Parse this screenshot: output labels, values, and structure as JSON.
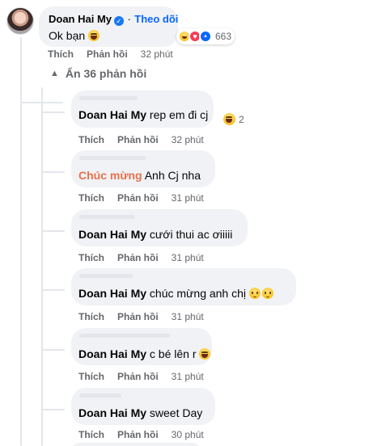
{
  "top_comment": {
    "author": "Doan Hai My",
    "separator": "·",
    "follow_label": "Theo dõi",
    "text": "Ok bạn",
    "reaction_count": "663",
    "like_label": "Thích",
    "reply_label": "Phản hồi",
    "time": "32 phút"
  },
  "hide_replies_label": "Ẩn 36 phản hồi",
  "replies": [
    {
      "name": "Doan Hai My",
      "text": "rep em đi cj",
      "react_count": "2",
      "like": "Thích",
      "reply": "Phản hồi",
      "time": "32 phút"
    },
    {
      "name": "Chúc mừng",
      "text": "Anh Cj nha",
      "like": "Thích",
      "reply": "Phản hồi",
      "time": "31 phút"
    },
    {
      "name": "Doan Hai My",
      "text": "cưới thui ac ơiiiii",
      "like": "Thích",
      "reply": "Phản hồi",
      "time": "31 phút"
    },
    {
      "name": "Doan Hai My",
      "text": "chúc mừng anh chị",
      "like": "Thích",
      "reply": "Phản hồi",
      "time": "31 phút"
    },
    {
      "name": "Doan Hai My",
      "text": "c bé lên r",
      "like": "Thích",
      "reply": "Phản hồi",
      "time": "31 phút"
    },
    {
      "name": "Doan Hai My",
      "text": "sweet Day",
      "like": "Thích",
      "reply": "Phản hồi",
      "time": "30 phút"
    }
  ],
  "colors": {
    "bubble": "#f0f2f5",
    "link_blue": "#0866ff",
    "secondary_text": "#65676b",
    "highlight_name": "#e9714a"
  },
  "icons": [
    "verified-badge-icon",
    "haha-emoji-icon",
    "love-reaction-icon",
    "like-reaction-icon",
    "chevron-up-icon",
    "blush-emoji-icon"
  ]
}
